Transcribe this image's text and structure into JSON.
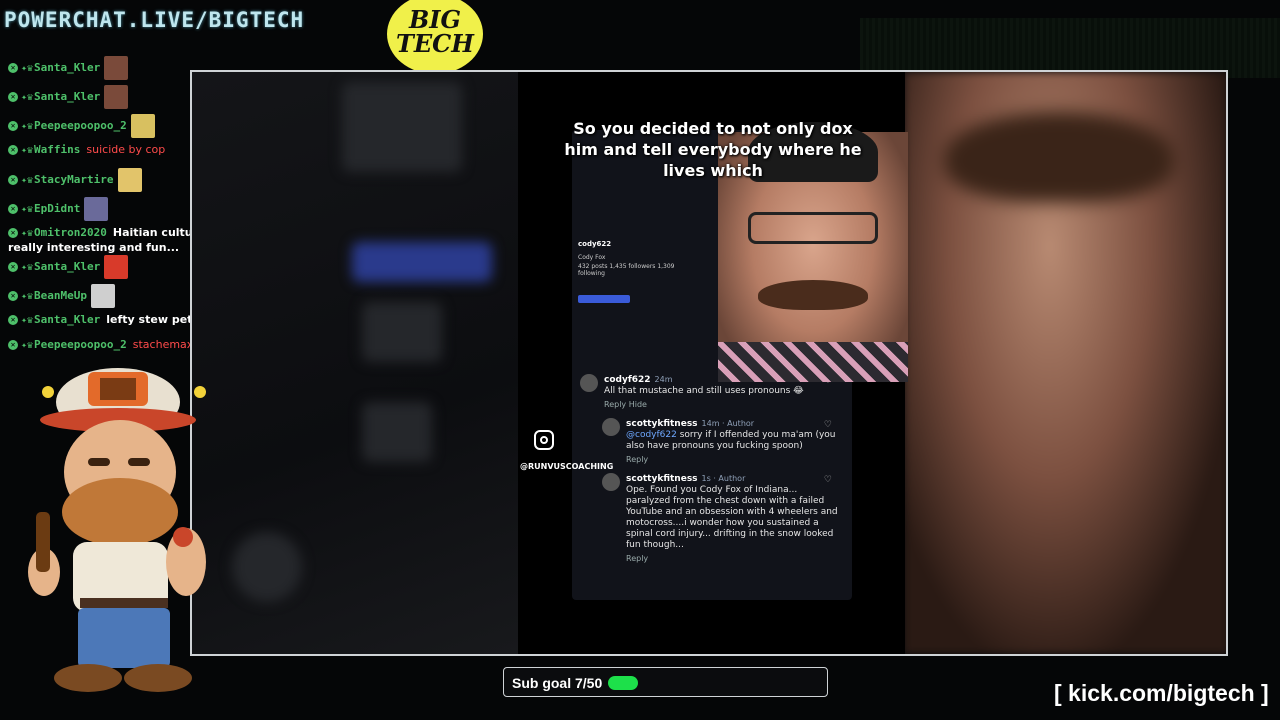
{
  "header": {
    "title": "POWERCHAT.LIVE/BIGTECH",
    "logo_text": "BIG TECH"
  },
  "chat": [
    {
      "user": "Santa_Kler",
      "text": "",
      "emote": "face"
    },
    {
      "user": "Santa_Kler",
      "text": "",
      "emote": "face"
    },
    {
      "user": "Peepeepoopoo_2",
      "text": "",
      "emote": "hand"
    },
    {
      "user": "Waffins",
      "text": "suicide by cop",
      "red": true
    },
    {
      "user": "StacyMartire",
      "text": "",
      "emote": "clap"
    },
    {
      "user": "EpDidnt",
      "text": "",
      "emote": "chip"
    },
    {
      "user": "Omitron2020",
      "text": "Haitian cultural history is really interesting and fun..."
    },
    {
      "user": "Santa_Kler",
      "text": "",
      "emote": "jg"
    },
    {
      "user": "BeanMeUp",
      "text": "",
      "emote": "feather"
    },
    {
      "user": "Santa_Kler",
      "text": "lefty stew peters"
    },
    {
      "user": "Peepeepoopoo_2",
      "text": "stachemaxxing",
      "red": true
    }
  ],
  "video": {
    "caption": "So you decided to not only dox him and tell everybody where he lives which",
    "profile_handle": "cody622",
    "profile_name": "Cody Fox",
    "profile_stats": "432 posts  1,435 followers  1,309 following",
    "instagram_handle": "@RUNVUSCOACHING",
    "comments": [
      {
        "user": "codyf622",
        "time": "24m",
        "text": "All that mustache and still uses pronouns 😂",
        "actions": "Reply   Hide",
        "indent": false
      },
      {
        "user": "scottykfitness",
        "time": "14m · Author",
        "mention": "@codyf622",
        "text": "sorry if I offended you ma'am (you also have pronouns you fucking spoon)",
        "actions": "Reply",
        "indent": true
      },
      {
        "user": "scottykfitness",
        "time": "1s · Author",
        "text": "Ope. Found you Cody Fox of Indiana... paralyzed from the chest down with a failed YouTube and an obsession with 4 wheelers and motocross....i wonder how you sustained a spinal cord injury... drifting in the snow looked fun though...",
        "actions": "Reply",
        "indent": true
      }
    ]
  },
  "subgoal": {
    "label": "Sub goal 7/50",
    "progress": 0.14
  },
  "footer": {
    "kick_url": "[ kick.com/bigtech ]"
  },
  "colors": {
    "accent_green": "#1de04a",
    "chat_user": "#4ec06a",
    "header_text": "#bfe6ee",
    "logo_yellow": "#f0f04a"
  }
}
